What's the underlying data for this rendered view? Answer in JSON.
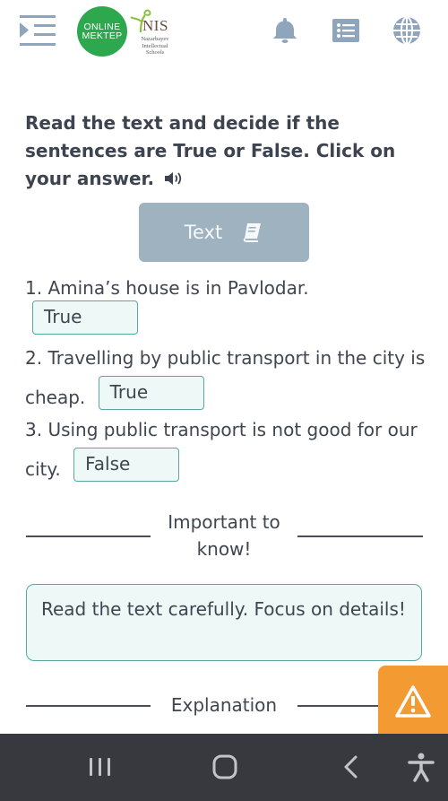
{
  "header": {
    "menu_icon": "menu-collapse-icon",
    "logo_online_mektep": {
      "line1": "ONLINE",
      "line2": "MEKTEP",
      "color": "#2ea84f"
    },
    "logo_nis": {
      "title": "NIS",
      "subtitle_lines": [
        "Nazarbayev",
        "Intellectual",
        "Schools"
      ]
    },
    "icons": [
      "bell-icon",
      "list-icon",
      "globe-icon"
    ],
    "icon_color": "#8fa5bb"
  },
  "task": {
    "instruction": "Read the text and decide if the sentences are True or False. Click on your answer.",
    "audio_icon": "speaker-icon",
    "text_button": {
      "label": "Text",
      "icon": "book-icon",
      "color": "#9eb2c0"
    }
  },
  "questions": [
    {
      "text": "1. Amina’s house is in Pavlodar.",
      "answer": "True"
    },
    {
      "text": "2. Travelling by public transport in the city is cheap.",
      "answer": "True"
    },
    {
      "text": "3. Using public transport is not good for our city.",
      "answer": "False"
    }
  ],
  "important": {
    "heading_line1": "Important to",
    "heading_line2": "know!",
    "tip": "Read the text carefully. Focus on details!"
  },
  "explanation": {
    "heading": "Explanation"
  },
  "alert_button": {
    "icon": "warning-icon",
    "color": "#f39a32"
  },
  "system_nav": {
    "icons": [
      "recent-apps-icon",
      "home-icon",
      "back-icon",
      "accessibility-icon"
    ],
    "background": "#37393e"
  }
}
